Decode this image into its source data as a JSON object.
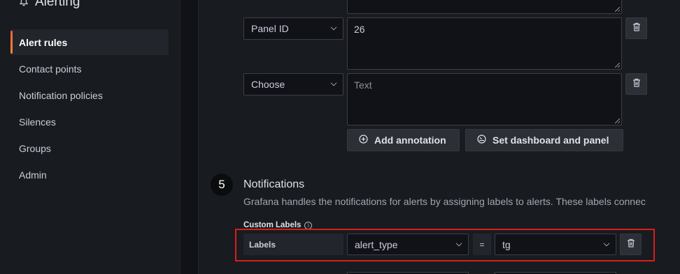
{
  "sidebar": {
    "title": "Alerting",
    "items": [
      {
        "label": "Alert rules",
        "active": true
      },
      {
        "label": "Contact points",
        "active": false
      },
      {
        "label": "Notification policies",
        "active": false
      },
      {
        "label": "Silences",
        "active": false
      },
      {
        "label": "Groups",
        "active": false
      },
      {
        "label": "Admin",
        "active": false
      }
    ]
  },
  "annotations": {
    "rows": [
      {
        "key": "Panel ID",
        "value": "26",
        "placeholder": ""
      },
      {
        "key": "Choose",
        "value": "",
        "placeholder": "Text"
      }
    ],
    "add_label": "Add annotation",
    "set_dashboard_label": "Set dashboard and panel"
  },
  "notifications": {
    "step": "5",
    "title": "Notifications",
    "description": "Grafana handles the notifications for alerts by assigning labels to alerts. These labels connec",
    "custom_labels_title": "Custom Labels",
    "info_glyph": "i",
    "label_row": {
      "prefix": "Labels",
      "key": "alert_type",
      "operator": "=",
      "value": "tg"
    }
  },
  "colors": {
    "accent": "#f55f3e",
    "highlight": "#d81e1e",
    "background": "#111217",
    "panel": "#181b1f"
  }
}
